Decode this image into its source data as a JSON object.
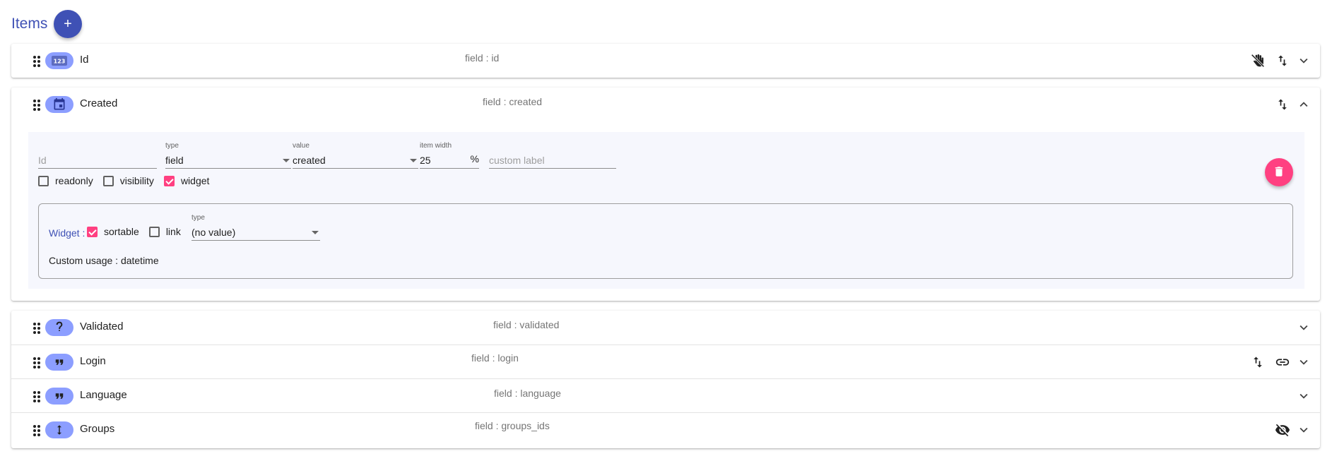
{
  "header": {
    "title": "Items",
    "add_label": "+"
  },
  "items": [
    {
      "label": "Id",
      "field": "field : id",
      "icon": "numeric-icon",
      "actions": [
        "hand-off-icon",
        "sort-icon",
        "chevron-down-icon"
      ]
    },
    {
      "label": "Created",
      "field": "field : created",
      "icon": "calendar-icon",
      "actions": [
        "sort-icon",
        "chevron-up-icon"
      ],
      "expanded": true
    },
    {
      "label": "Validated",
      "field": "field : validated",
      "icon": "question-icon",
      "actions": [
        "chevron-down-icon"
      ]
    },
    {
      "label": "Login",
      "field": "field : login",
      "icon": "quote-icon",
      "actions": [
        "sort-icon",
        "link-icon",
        "chevron-down-icon"
      ]
    },
    {
      "label": "Language",
      "field": "field : language",
      "icon": "quote-icon",
      "actions": [
        "chevron-down-icon"
      ]
    },
    {
      "label": "Groups",
      "field": "field : groups_ids",
      "icon": "vertical-arrows-icon",
      "actions": [
        "eye-off-icon",
        "chevron-down-icon"
      ]
    }
  ],
  "editor": {
    "id": {
      "placeholder": "Id",
      "value": ""
    },
    "type": {
      "caption": "type",
      "value": "field"
    },
    "value": {
      "caption": "value",
      "value": "created"
    },
    "width": {
      "caption": "item width",
      "value": "25",
      "unit": "%"
    },
    "custom_label": {
      "placeholder": "custom label",
      "value": ""
    },
    "checks": [
      {
        "label": "readonly",
        "checked": false
      },
      {
        "label": "visibility",
        "checked": false
      },
      {
        "label": "widget",
        "checked": true
      }
    ],
    "widget": {
      "label": "Widget :",
      "sortable": {
        "label": "sortable",
        "checked": true
      },
      "link": {
        "label": "link",
        "checked": false
      },
      "type": {
        "caption": "type",
        "value": "(no value)"
      },
      "usage": "Custom usage : datetime"
    }
  },
  "colors": {
    "primary": "#3f51b5",
    "accent": "#ff4081",
    "pill": "#8c9eff",
    "muted": "#757575"
  }
}
